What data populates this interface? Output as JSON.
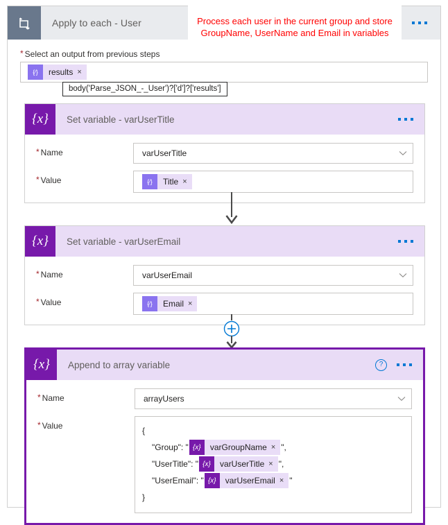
{
  "annotation": {
    "text": "Process each user in the current group and store GroupName, UserName and Email in variables"
  },
  "loop": {
    "title": "Apply to each - User",
    "icon": "loop-icon",
    "menu": "more-commands",
    "output_field": {
      "label": "Select an output from previous steps",
      "token": "results",
      "token_icon": "{⁄}",
      "remove": "×"
    },
    "tooltip": "body('Parse_JSON_-_User')?['d']?['results']"
  },
  "cards": [
    {
      "title": "Set variable - varUserTitle",
      "icon": "{x}",
      "has_help": false,
      "selected": false,
      "name_label": "Name",
      "name_value": "varUserTitle",
      "value_label": "Value",
      "value_token": "Title",
      "value_token_icon": "{⁄}",
      "remove": "×",
      "chevron": "⌄"
    },
    {
      "title": "Set variable - varUserEmail",
      "icon": "{x}",
      "has_help": false,
      "selected": false,
      "name_label": "Name",
      "name_value": "varUserEmail",
      "value_label": "Value",
      "value_token": "Email",
      "value_token_icon": "{⁄}",
      "remove": "×",
      "chevron": "⌄"
    }
  ],
  "append_card": {
    "title": "Append to array variable",
    "icon": "{x}",
    "help": "?",
    "menu": "more-commands",
    "selected": true,
    "name_label": "Name",
    "name_value": "arrayUsers",
    "value_label": "Value",
    "chevron": "⌄",
    "json": {
      "open_brace": "{",
      "close_brace": "}",
      "lines": [
        {
          "key": "\"Group\": \"",
          "token": "varGroupName",
          "token_icon": "{x}",
          "remove": "×",
          "suffix": "\","
        },
        {
          "key": "\"UserTitle\": \"",
          "token": "varUserTitle",
          "token_icon": "{x}",
          "remove": "×",
          "suffix": "\","
        },
        {
          "key": "\"UserEmail\": \"",
          "token": "varUserEmail",
          "token_icon": "{x}",
          "remove": "×",
          "suffix": "\""
        }
      ]
    }
  },
  "connectors": {
    "add_step": "+"
  },
  "colors": {
    "accent_purple": "#7719aa",
    "chip_purple": "#8a73ef",
    "chip_bg": "#e9ddf7",
    "card_header_bg": "#e9dcf6",
    "loop_header_bg": "#e9ebee",
    "loop_icon_bg": "#69788c",
    "blue": "#0078d4",
    "annotation_red": "#ff0000",
    "required_red": "#a4262c"
  }
}
